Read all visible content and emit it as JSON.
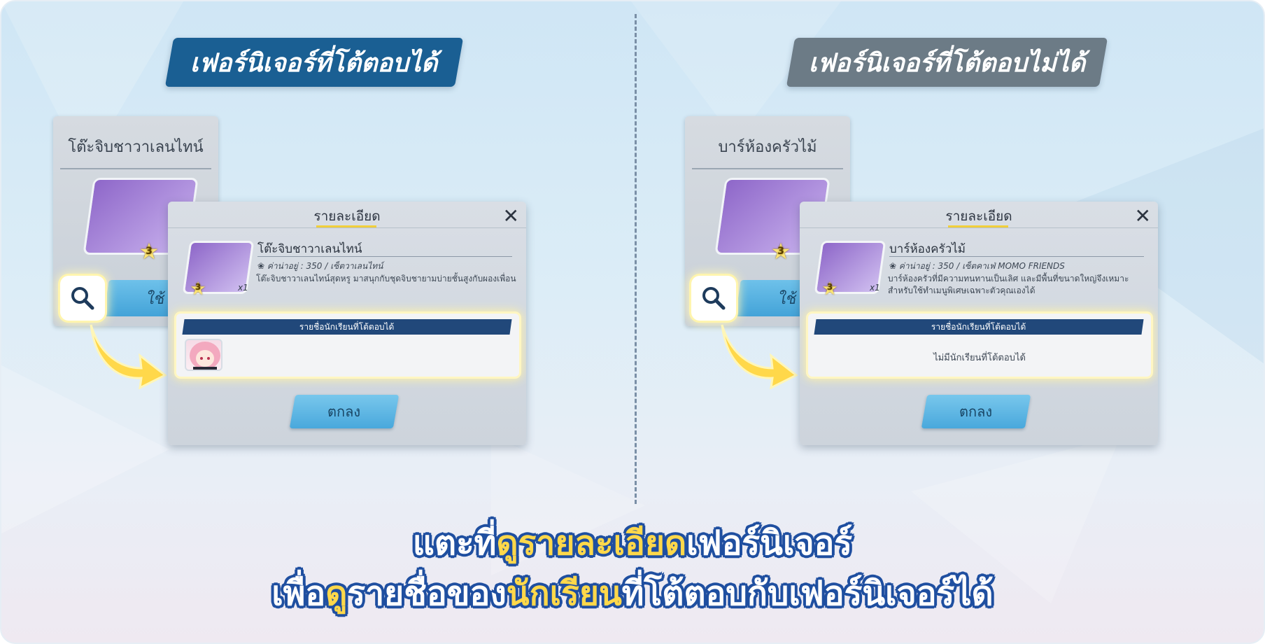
{
  "left": {
    "banner": "เฟอร์นิเจอร์ที่โต้ตอบได้",
    "back_card": {
      "title": "โต๊ะจิบชาวาเลนไทน์",
      "use_label": "ใช้",
      "count": "x",
      "rarity": "3"
    },
    "dialog": {
      "title": "รายละเอียด",
      "close": "✕",
      "item_name": "โต๊ะจิบชาวาเลนไทน์",
      "meta": "ค่าน่าอยู่ : 350  /  เซ็ตวาเลนไทน์",
      "description": "โต๊ะจิบชาวาเลนไทน์สุดหรู มาสนุกกับชุดจิบชายามบ่ายชั้นสูงกับผองเพื่อน",
      "rarity": "3",
      "count": "x1",
      "student_header": "รายชื่อนักเรียนที่โต้ตอบได้",
      "ok_label": "ตกลง"
    }
  },
  "right": {
    "banner": "เฟอร์นิเจอร์ที่โต้ตอบไม่ได้",
    "back_card": {
      "title": "บาร์ห้องครัวไม้",
      "use_label": "ใช้",
      "count": "x",
      "rarity": "3"
    },
    "dialog": {
      "title": "รายละเอียด",
      "close": "✕",
      "item_name": "บาร์ห้องครัวไม้",
      "meta": "ค่าน่าอยู่ : 350  /  เซ็ตคาเฟ่ MOMO FRIENDS",
      "description": "บาร์ห้องครัวที่มีความทนทานเป็นเลิศ และมีพื้นที่ขนาดใหญ่จึงเหมาะสำหรับใช้ทำเมนูพิเศษเฉพาะตัวคุณเองได้",
      "rarity": "3",
      "count": "x1",
      "student_header": "รายชื่อนักเรียนที่โต้ตอบได้",
      "student_empty": "ไม่มีนักเรียนที่โต้ตอบได้",
      "ok_label": "ตกลง"
    }
  },
  "footer": {
    "line1": {
      "a": "แตะที่",
      "b": "ดูรายละเอียด",
      "c": "เฟอร์นิเจอร์"
    },
    "line2": {
      "a": "เพื่อ",
      "b": "ดู",
      "c": "รายชื่อของ",
      "d": "นักเรียน",
      "e": "ที่โต้ตอบกับเฟอร์นิเจอร์ได้"
    }
  },
  "colors": {
    "banner_left": "#1a5f93",
    "banner_right": "#6c7b86",
    "accent_yellow": "#ffd84a",
    "button_blue": "#49a8dc",
    "student_bar": "#21487a"
  },
  "icons": [
    "magnifier-icon",
    "arrow-icon",
    "close-icon",
    "star-icon",
    "affection-icon"
  ]
}
